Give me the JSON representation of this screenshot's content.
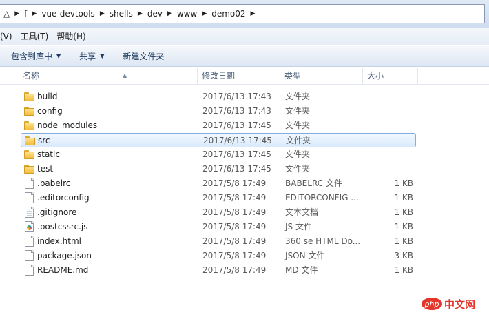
{
  "address": {
    "crumbs": [
      "△",
      "f",
      "vue-devtools",
      "shells",
      "dev",
      "www",
      "demo02"
    ]
  },
  "menu": {
    "items": [
      "(V)",
      "工具(T)",
      "帮助(H)"
    ]
  },
  "commands": {
    "include_library": "包含到库中",
    "share": "共享",
    "new_folder": "新建文件夹"
  },
  "columns": {
    "name": "名称",
    "modified": "修改日期",
    "type": "类型",
    "size": "大小"
  },
  "files": [
    {
      "name": "build",
      "modified": "2017/6/13 17:43",
      "type": "文件夹",
      "size": "",
      "icon": "folder-icon"
    },
    {
      "name": "config",
      "modified": "2017/6/13 17:43",
      "type": "文件夹",
      "size": "",
      "icon": "folder-icon"
    },
    {
      "name": "node_modules",
      "modified": "2017/6/13 17:45",
      "type": "文件夹",
      "size": "",
      "icon": "folder-icon"
    },
    {
      "name": "src",
      "modified": "2017/6/13 17:45",
      "type": "文件夹",
      "size": "",
      "icon": "folder-icon",
      "selected": true
    },
    {
      "name": "static",
      "modified": "2017/6/13 17:45",
      "type": "文件夹",
      "size": "",
      "icon": "folder-icon"
    },
    {
      "name": "test",
      "modified": "2017/6/13 17:45",
      "type": "文件夹",
      "size": "",
      "icon": "folder-icon"
    },
    {
      "name": ".babelrc",
      "modified": "2017/5/8 17:49",
      "type": "BABELRC 文件",
      "size": "1 KB",
      "icon": "file-icon"
    },
    {
      "name": ".editorconfig",
      "modified": "2017/5/8 17:49",
      "type": "EDITORCONFIG ...",
      "size": "1 KB",
      "icon": "file-icon"
    },
    {
      "name": ".gitignore",
      "modified": "2017/5/8 17:49",
      "type": "文本文档",
      "size": "1 KB",
      "icon": "text-file-icon"
    },
    {
      "name": ".postcssrc.js",
      "modified": "2017/5/8 17:49",
      "type": "JS 文件",
      "size": "1 KB",
      "icon": "js-file-icon"
    },
    {
      "name": "index.html",
      "modified": "2017/5/8 17:49",
      "type": "360 se HTML Do...",
      "size": "1 KB",
      "icon": "file-icon"
    },
    {
      "name": "package.json",
      "modified": "2017/5/8 17:49",
      "type": "JSON 文件",
      "size": "3 KB",
      "icon": "file-icon"
    },
    {
      "name": "README.md",
      "modified": "2017/5/8 17:49",
      "type": "MD 文件",
      "size": "1 KB",
      "icon": "file-icon"
    }
  ],
  "watermark": {
    "logo": "php",
    "text": "中文网"
  }
}
